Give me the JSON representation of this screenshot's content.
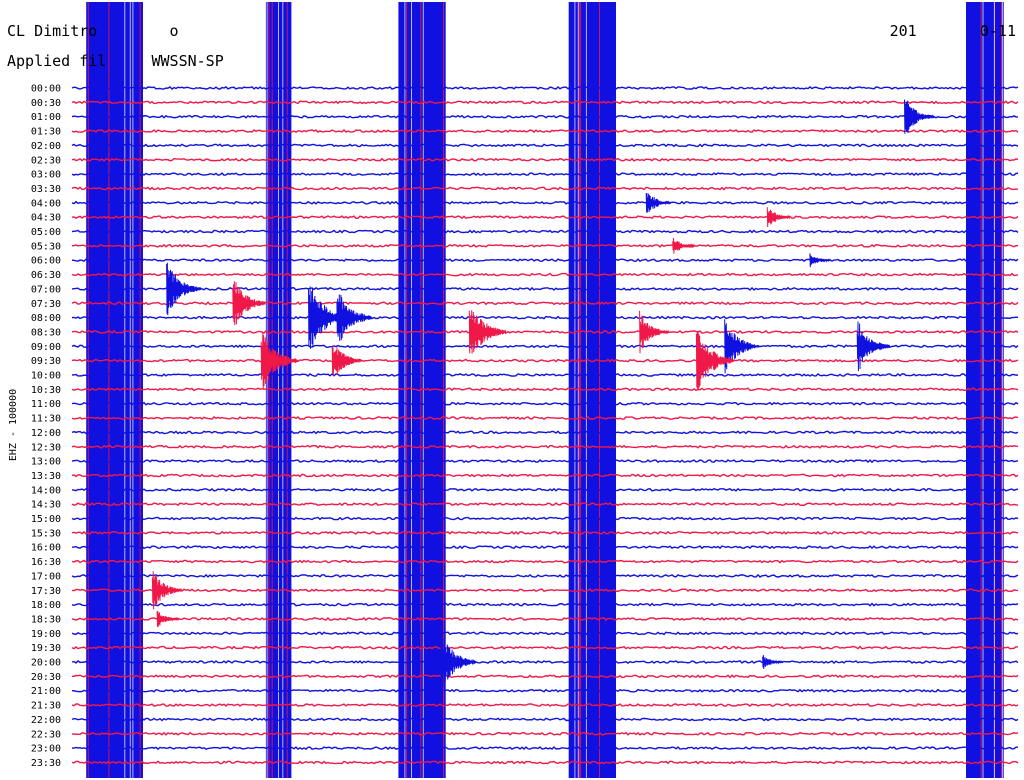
{
  "header": {
    "station_title": "CL Dimitro        o",
    "filter_label": "Applied fil     WWSSN-SP",
    "date_label": "201       0-11"
  },
  "channel_label": "EHZ - 100000",
  "colors": {
    "trace_blue": "#1010e0",
    "trace_red": "#f01848",
    "background": "#ffffff",
    "text": "#000000"
  },
  "chart_data": {
    "type": "helicorder",
    "row_labels": [
      "00:00",
      "00:30",
      "01:00",
      "01:30",
      "02:00",
      "02:30",
      "03:00",
      "03:30",
      "04:00",
      "04:30",
      "05:00",
      "05:30",
      "06:00",
      "06:30",
      "07:00",
      "07:30",
      "08:00",
      "08:30",
      "09:00",
      "09:30",
      "10:00",
      "10:30",
      "11:00",
      "11:30",
      "12:00",
      "12:30",
      "13:00",
      "13:30",
      "14:00",
      "14:30",
      "15:00",
      "15:30",
      "16:00",
      "16:30",
      "17:00",
      "17:30",
      "18:00",
      "18:30",
      "19:00",
      "19:30",
      "20:00",
      "20:30",
      "21:00",
      "21:30",
      "22:00",
      "22:30",
      "23:00",
      "23:30"
    ],
    "row_color_cycle": [
      "trace_blue",
      "trace_red"
    ],
    "saturated_bands": [
      {
        "start": 0.015,
        "end": 0.075
      },
      {
        "start": 0.205,
        "end": 0.232
      },
      {
        "start": 0.345,
        "end": 0.395
      },
      {
        "start": 0.525,
        "end": 0.575
      },
      {
        "start": 0.945,
        "end": 0.985
      }
    ],
    "events": [
      {
        "row": 2,
        "at": 0.88,
        "amp": 22
      },
      {
        "row": 8,
        "at": 0.607,
        "amp": 14
      },
      {
        "row": 9,
        "at": 0.735,
        "amp": 12
      },
      {
        "row": 11,
        "at": 0.635,
        "amp": 10
      },
      {
        "row": 12,
        "at": 0.78,
        "amp": 8
      },
      {
        "row": 14,
        "at": 0.1,
        "amp": 30
      },
      {
        "row": 15,
        "at": 0.17,
        "amp": 28
      },
      {
        "row": 16,
        "at": 0.25,
        "amp": 40
      },
      {
        "row": 16,
        "at": 0.28,
        "amp": 32
      },
      {
        "row": 17,
        "at": 0.42,
        "amp": 34
      },
      {
        "row": 17,
        "at": 0.6,
        "amp": 22
      },
      {
        "row": 18,
        "at": 0.69,
        "amp": 30
      },
      {
        "row": 18,
        "at": 0.83,
        "amp": 28
      },
      {
        "row": 19,
        "at": 0.66,
        "amp": 36
      },
      {
        "row": 19,
        "at": 0.2,
        "amp": 34
      },
      {
        "row": 19,
        "at": 0.275,
        "amp": 22
      },
      {
        "row": 35,
        "at": 0.085,
        "amp": 22
      },
      {
        "row": 37,
        "at": 0.09,
        "amp": 10
      },
      {
        "row": 40,
        "at": 0.39,
        "amp": 32
      },
      {
        "row": 40,
        "at": 0.73,
        "amp": 8
      }
    ]
  }
}
